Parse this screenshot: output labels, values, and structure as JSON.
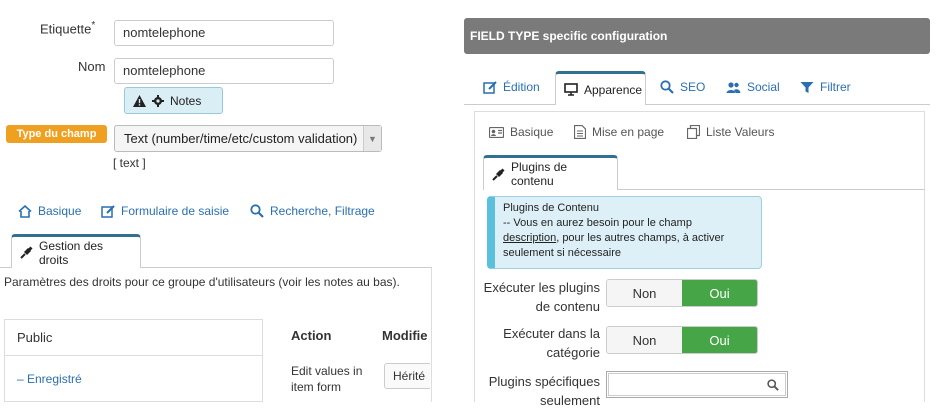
{
  "left": {
    "label_field": {
      "label": "Etiquette",
      "required": "*",
      "value": "nomtelephone"
    },
    "name_field": {
      "label": "Nom",
      "value": "nomtelephone"
    },
    "notes_badge": {
      "label": "Notes"
    },
    "field_type": {
      "badge": "Type du champ",
      "selected": "Text (number/time/etc/custom validation)",
      "hint": "[ text ]"
    },
    "tabs": [
      {
        "label": "Basique",
        "icon": "home-icon"
      },
      {
        "label": "Formulaire de saisie",
        "icon": "edit-icon"
      },
      {
        "label": "Recherche, Filtrage",
        "icon": "search-icon"
      }
    ],
    "active_tab": {
      "label": "Gestion des droits",
      "icon": "plug-icon"
    },
    "permissions": {
      "description": "Paramètres des droits pour ce groupe d'utilisateurs (voir les notes au bas).",
      "groups": [
        "Public",
        "– Enregistré"
      ],
      "columns": [
        "Action",
        "Modifie"
      ],
      "row_action": "Edit values in item form",
      "row_value": "Hérité"
    }
  },
  "right": {
    "header": "FIELD TYPE specific configuration",
    "tabs": [
      {
        "label": "Édition",
        "icon": "edit-icon"
      },
      {
        "label": "Apparence",
        "icon": "monitor-icon",
        "active": true
      },
      {
        "label": "SEO",
        "icon": "search-icon"
      },
      {
        "label": "Social",
        "icon": "users-icon"
      },
      {
        "label": "Filtrer",
        "icon": "filter-icon"
      }
    ],
    "subtabs": [
      {
        "label": "Basique",
        "icon": "id-card-icon"
      },
      {
        "label": "Mise en page",
        "icon": "document-icon"
      },
      {
        "label": "Liste Valeurs",
        "icon": "copy-icon"
      }
    ],
    "active_subtab": {
      "label": "Plugins de contenu",
      "icon": "plug-icon"
    },
    "info": {
      "title": "Plugins de Contenu",
      "line1": "-- Vous en aurez besoin pour le champ",
      "link": "description",
      "line2": ", pour les autres champs, à activer",
      "line3": "seulement si nécessaire"
    },
    "settings": [
      {
        "label_line1": "Exécuter les plugins",
        "label_line2": "de contenu",
        "off": "Non",
        "on": "Oui"
      },
      {
        "label_line1": "Exécuter dans la",
        "label_line2": "catégorie",
        "off": "Non",
        "on": "Oui"
      }
    ],
    "specific_plugins": {
      "label_line1": "Plugins spécifiques",
      "label_line2": "seulement",
      "placeholder": ""
    }
  }
}
